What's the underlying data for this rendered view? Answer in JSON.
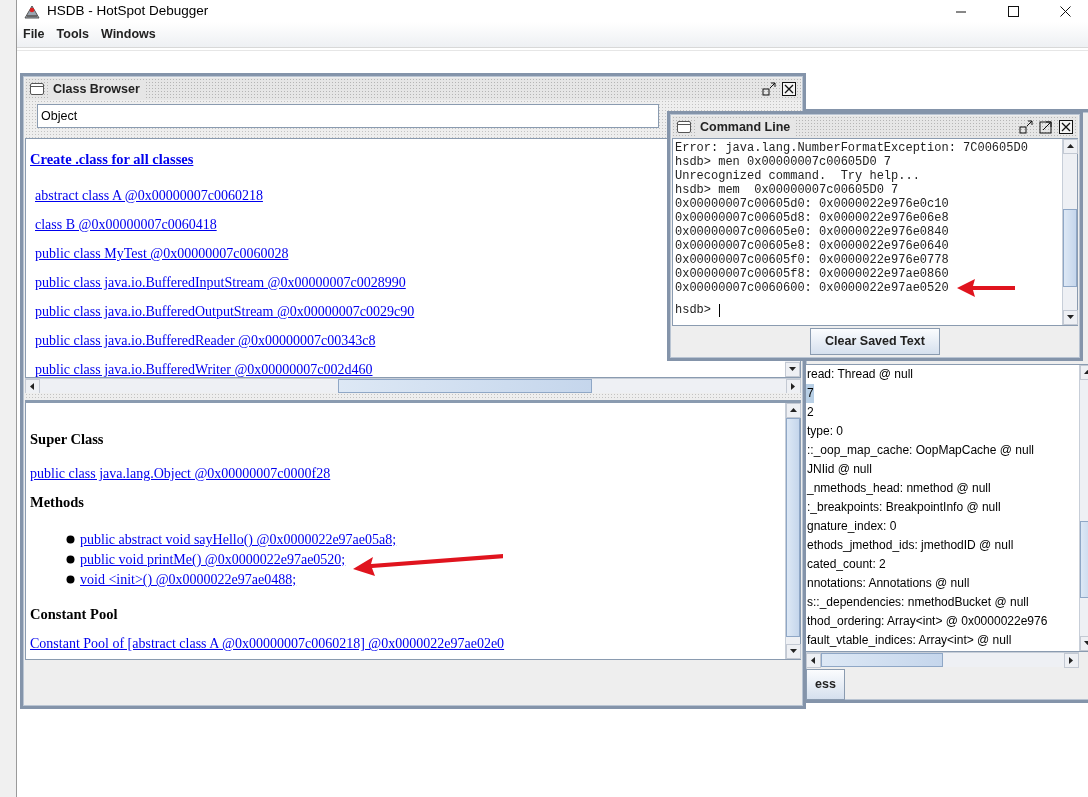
{
  "window": {
    "title": "HSDB - HotSpot Debugger"
  },
  "menu": [
    {
      "label": "File"
    },
    {
      "label": "Tools"
    },
    {
      "label": "Windows"
    }
  ],
  "class_browser": {
    "title": "Class Browser",
    "filter": "Object",
    "create_link": "Create .class for all classes",
    "classes": [
      "abstract class A @0x00000007c0060218",
      "class B @0x00000007c0060418",
      "public class MyTest @0x00000007c0060028",
      "public class java.io.BufferedInputStream @0x00000007c0028990",
      "public class java.io.BufferedOutputStream @0x00000007c0029c90",
      "public class java.io.BufferedReader @0x00000007c00343c8",
      "public class java.io.BufferedWriter @0x00000007c002d460"
    ],
    "super_class": {
      "heading": "Super Class",
      "link": "public class java.lang.Object @0x00000007c0000f28"
    },
    "methods": {
      "heading": "Methods",
      "items": [
        "public abstract void sayHello() @0x0000022e97ae05a8;",
        "public void printMe() @0x0000022e97ae0520;",
        "void <init>() @0x0000022e97ae0488;"
      ]
    },
    "constant_pool": {
      "heading": "Constant Pool",
      "link": "Constant Pool of [abstract class A @0x00000007c0060218] @0x0000022e97ae02e0"
    }
  },
  "inspector": {
    "fields": [
      {
        "text": "read: Thread @ null",
        "selected": false
      },
      {
        "text": "7",
        "selected": true
      },
      {
        "text": "2",
        "selected": false
      },
      {
        "text": "type: 0",
        "selected": false
      },
      {
        "text": "::_oop_map_cache: OopMapCache @ null",
        "selected": false
      },
      {
        "text": "JNIid @ null",
        "selected": false
      },
      {
        "text": "_nmethods_head: nmethod @ null",
        "selected": false
      },
      {
        "text": ":_breakpoints: BreakpointInfo @ null",
        "selected": false
      },
      {
        "text": "gnature_index: 0",
        "selected": false
      },
      {
        "text": "ethods_jmethod_ids: jmethodID @ null",
        "selected": false
      },
      {
        "text": "cated_count: 2",
        "selected": false
      },
      {
        "text": "nnotations: Annotations @ null",
        "selected": false
      },
      {
        "text": "s::_dependencies: nmethodBucket @ null",
        "selected": false
      },
      {
        "text": "thod_ordering: Array<int> @ 0x0000022e976",
        "selected": false
      },
      {
        "text": "fault_vtable_indices: Array<int> @ null",
        "selected": false
      }
    ],
    "button": "ess"
  },
  "command_line": {
    "title": "Command Line",
    "lines": [
      "Error: java.lang.NumberFormatException: 7C00605D0",
      "hsdb> men 0x00000007c00605D0 7",
      "Unrecognized command.  Try help...",
      "hsdb> mem  0x00000007c00605D0 7",
      "0x00000007c00605d0: 0x0000022e976e0c10",
      "0x00000007c00605d8: 0x0000022e976e06e8",
      "0x00000007c00605e0: 0x0000022e976e0840",
      "0x00000007c00605e8: 0x0000022e976e0640",
      "0x00000007c00605f0: 0x0000022e976e0778",
      "0x00000007c00605f8: 0x0000022e97ae0860",
      "0x00000007c0060600: 0x0000022e97ae0520"
    ],
    "prompt": "hsdb>",
    "button": "Clear Saved Text"
  }
}
